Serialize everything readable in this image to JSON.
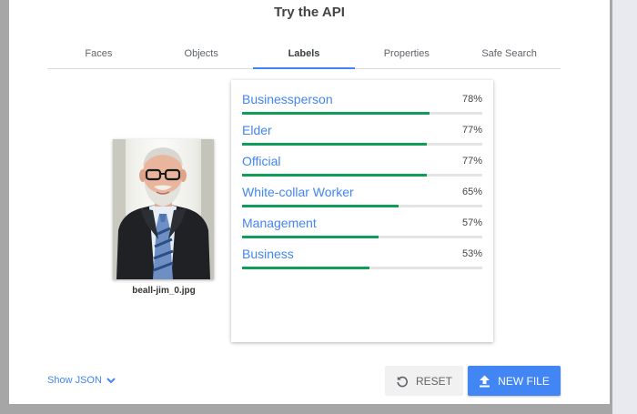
{
  "title": "Try the API",
  "tabs": [
    {
      "label": "Faces"
    },
    {
      "label": "Objects"
    },
    {
      "label": "Labels"
    },
    {
      "label": "Properties"
    },
    {
      "label": "Safe Search"
    }
  ],
  "active_tab": "Labels",
  "image": {
    "filename": "beall-jim_0.jpg"
  },
  "labels": [
    {
      "name": "Businessperson",
      "score": "78%",
      "fraction": 0.78
    },
    {
      "name": "Elder",
      "score": "77%",
      "fraction": 0.77
    },
    {
      "name": "Official",
      "score": "77%",
      "fraction": 0.77
    },
    {
      "name": "White-collar Worker",
      "score": "65%",
      "fraction": 0.65
    },
    {
      "name": "Management",
      "score": "57%",
      "fraction": 0.57
    },
    {
      "name": "Business",
      "score": "53%",
      "fraction": 0.53
    }
  ],
  "actions": {
    "show_json": "Show JSON",
    "reset": "RESET",
    "new_file": "NEW FILE"
  },
  "icons": {
    "show_json": "chevron-down-icon",
    "reset": "reset-icon",
    "new_file": "upload-icon"
  },
  "colors": {
    "accent": "#4285f4",
    "bar": "#0f9d58",
    "bar_track": "#e4e4e4"
  }
}
